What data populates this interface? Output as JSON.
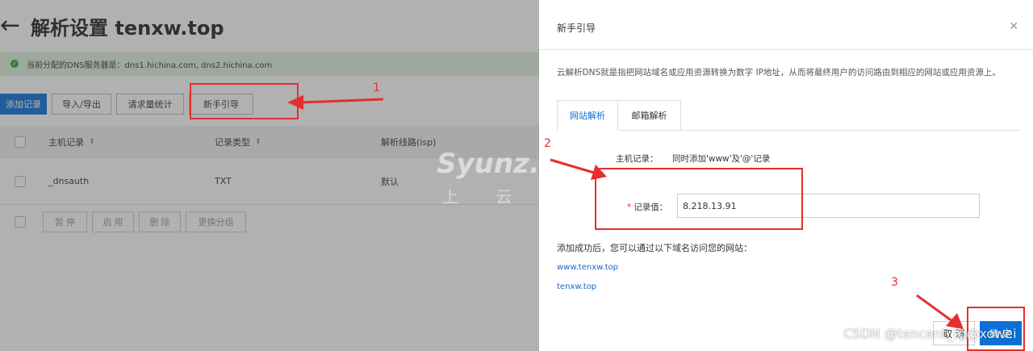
{
  "page": {
    "title": "解析设置 tenxw.top",
    "dns_notice": "当前分配的DNS服务器是：dns1.hichina.com, dns2.hichina.com"
  },
  "toolbar": {
    "add_record": "添加记录",
    "import_export": "导入/导出",
    "request_stats": "请求量统计",
    "guide": "新手引导"
  },
  "table": {
    "columns": [
      "主机记录",
      "记录类型",
      "解析线路(isp)"
    ],
    "rows": [
      {
        "host": "_dnsauth",
        "type": "TXT",
        "line": "默认"
      }
    ]
  },
  "batch": {
    "pause": "暂 停",
    "enable": "启 用",
    "delete": "删 除",
    "change_group": "更换分组"
  },
  "modal": {
    "title": "新手引导",
    "intro": "云解析DNS就是指把网站域名或应用资源转换为数字 IP地址，从而将最终用户的访问路由到相应的网站或应用资源上。",
    "tabs": [
      "网站解析",
      "邮箱解析"
    ],
    "host_label": "主机记录：",
    "host_value": "同时添加'www'及'@'记录",
    "record_label": "记录值：",
    "record_value": "8.218.13.91",
    "success_text": "添加成功后，您可以通过以下域名访问您的网站：",
    "links": [
      "www.tenxw.top",
      "tenxw.top"
    ],
    "cancel": "取 消",
    "confirm": "确 定"
  },
  "annotations": {
    "step1": "1",
    "step2": "2",
    "step3": "3"
  },
  "watermarks": {
    "syunz": "Syunz.com",
    "syunz_cn": "上 云 教 程",
    "csdn": "CSDN @tencent_tg@xowei"
  },
  "colors": {
    "primary": "#0b6fd6",
    "annotation": "#e62e2e",
    "success": "#2bab36",
    "link": "#1868c6"
  }
}
